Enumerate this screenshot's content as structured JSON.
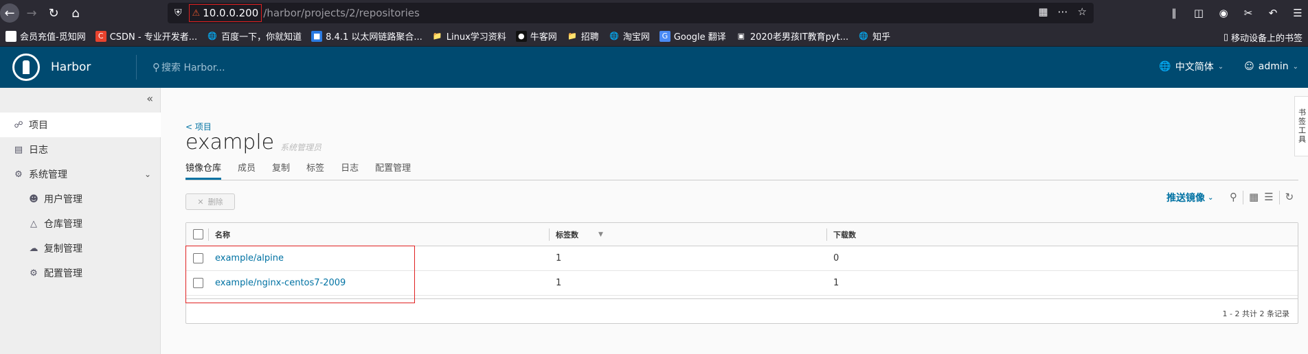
{
  "browser": {
    "url_host": "10.0.0.200",
    "url_path": "/harbor/projects/2/repositories"
  },
  "bookmarks": [
    {
      "label": "会员充值-觅知网",
      "icon": "mizhi-icon",
      "color": "#ffffff"
    },
    {
      "label": "CSDN - 专业开发者...",
      "icon": "csdn-icon",
      "color": "#e8432e"
    },
    {
      "label": "百度一下，你就知道",
      "icon": "globe-icon",
      "color": "#2b2a33"
    },
    {
      "label": "8.4.1 以太网链路聚合...",
      "icon": "bookmark-icon",
      "color": "#2a7ae2"
    },
    {
      "label": "Linux学习资料",
      "icon": "folder-icon",
      "color": "#2b2a33"
    },
    {
      "label": "牛客网",
      "icon": "nowcoder-icon",
      "color": "#111111"
    },
    {
      "label": "招聘",
      "icon": "folder-icon",
      "color": "#2b2a33"
    },
    {
      "label": "淘宝网",
      "icon": "globe-icon",
      "color": "#2b2a33"
    },
    {
      "label": "Google 翻译",
      "icon": "google-translate-icon",
      "color": "#4a8af4"
    },
    {
      "label": "2020老男孩IT教育pyt...",
      "icon": "bilibili-icon",
      "color": "#2b2a33"
    },
    {
      "label": "知乎",
      "icon": "globe-icon",
      "color": "#2b2a33"
    }
  ],
  "bookmarks_mobile": "移动设备上的书签",
  "header": {
    "app_name": "Harbor",
    "search_placeholder": "搜索 Harbor...",
    "language": "中文简体",
    "user": "admin"
  },
  "sidebar": {
    "items": [
      {
        "label": "项目",
        "icon": "projects-icon"
      },
      {
        "label": "日志",
        "icon": "logs-icon"
      },
      {
        "label": "系统管理",
        "icon": "admin-icon"
      },
      {
        "label": "用户管理",
        "icon": "users-icon"
      },
      {
        "label": "仓库管理",
        "icon": "registry-icon"
      },
      {
        "label": "复制管理",
        "icon": "replication-icon"
      },
      {
        "label": "配置管理",
        "icon": "config-icon"
      }
    ]
  },
  "project": {
    "back_label": "< 项目",
    "name": "example",
    "role": "系统管理员"
  },
  "tabs": [
    "镜像仓库",
    "成员",
    "复制",
    "标签",
    "日志",
    "配置管理"
  ],
  "toolbar": {
    "delete_label": "删除",
    "push_label": "推送镜像"
  },
  "grid": {
    "columns": [
      "名称",
      "标签数",
      "下载数"
    ],
    "rows": [
      {
        "name": "example/alpine",
        "tags": "1",
        "pulls": "0"
      },
      {
        "name": "example/nginx-centos7-2009",
        "tags": "1",
        "pulls": "1"
      }
    ],
    "footer": "1 - 2 共计 2 条记录"
  },
  "side_tab": "书签工具"
}
